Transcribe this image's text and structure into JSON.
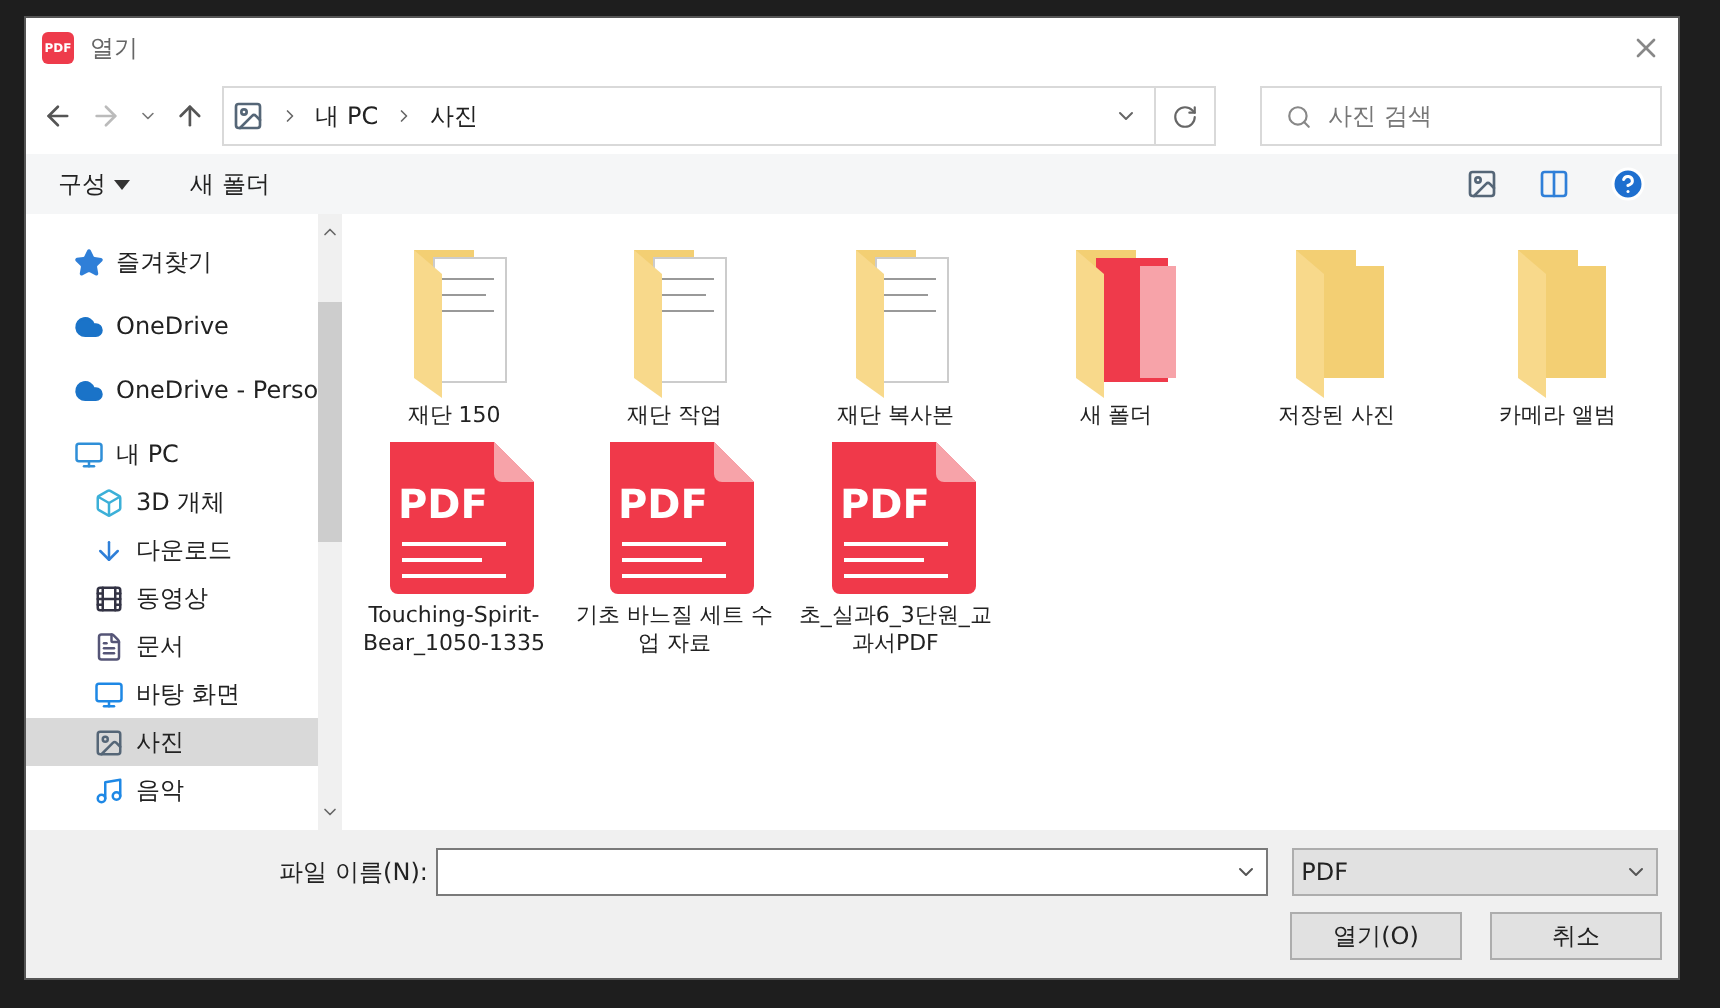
{
  "window": {
    "title": "열기",
    "app_icon": "PDF"
  },
  "address": {
    "path": [
      "내 PC",
      "사진"
    ]
  },
  "search": {
    "placeholder": "사진 검색"
  },
  "toolbar": {
    "organize": "구성",
    "new_folder": "새 폴더"
  },
  "sidebar": {
    "items": [
      {
        "label": "즐겨찾기",
        "kind": "star",
        "selected": false
      },
      {
        "label": "OneDrive",
        "kind": "cloud",
        "selected": false
      },
      {
        "label": "OneDrive - Perso",
        "kind": "cloud",
        "selected": false
      },
      {
        "label": "내 PC",
        "kind": "pc",
        "selected": false,
        "children": [
          {
            "label": "3D 개체",
            "kind": "cube",
            "selected": false
          },
          {
            "label": "다운로드",
            "kind": "download",
            "selected": false
          },
          {
            "label": "동영상",
            "kind": "video",
            "selected": false
          },
          {
            "label": "문서",
            "kind": "doc",
            "selected": false
          },
          {
            "label": "바탕 화면",
            "kind": "desktop",
            "selected": false
          },
          {
            "label": "사진",
            "kind": "picture",
            "selected": true
          },
          {
            "label": "음악",
            "kind": "music",
            "selected": false
          }
        ]
      }
    ]
  },
  "files": [
    {
      "name": "재단 150",
      "kind": "folder-doc"
    },
    {
      "name": "재단 작업",
      "kind": "folder-doc"
    },
    {
      "name": "재단 복사본",
      "kind": "folder-doc"
    },
    {
      "name": "새 폴더",
      "kind": "folder-pdf"
    },
    {
      "name": "저장된 사진",
      "kind": "folder"
    },
    {
      "name": "카메라 앨범",
      "kind": "folder"
    },
    {
      "name": "Touching-Spirit-Bear_1050-1335",
      "kind": "pdf",
      "badge": "PDF"
    },
    {
      "name": "기초 바느질 세트 수업 자료",
      "kind": "pdf",
      "badge": "PDF"
    },
    {
      "name": "초_실과6_3단원_교과서PDF",
      "kind": "pdf",
      "badge": "PDF"
    }
  ],
  "footer": {
    "filename_label": "파일 이름(N):",
    "filter": "PDF",
    "open": "열기(O)",
    "cancel": "취소"
  }
}
